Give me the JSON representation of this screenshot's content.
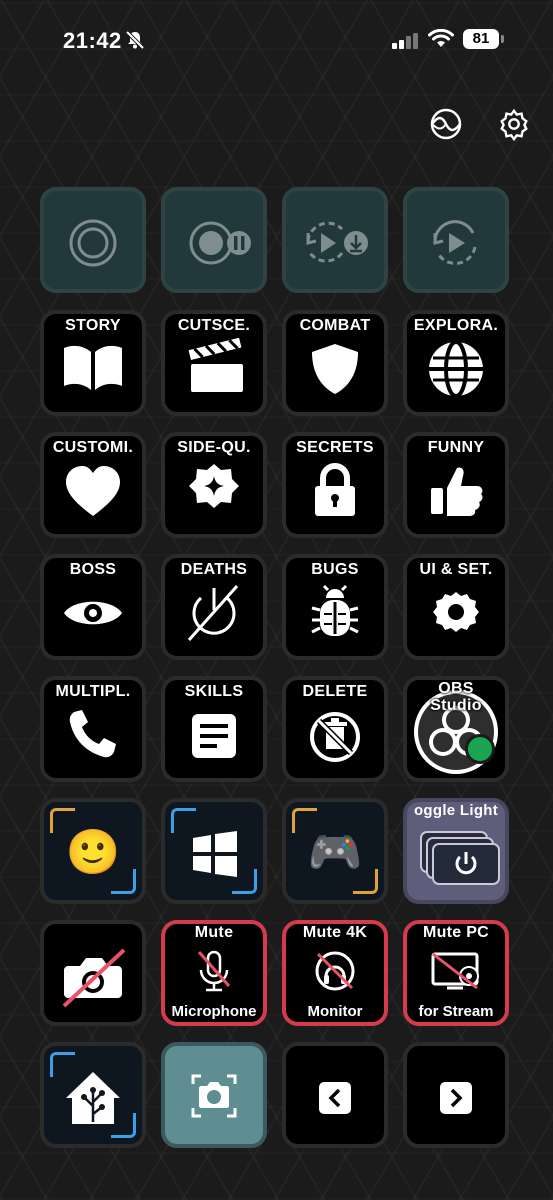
{
  "status_bar": {
    "time": "21:42",
    "battery": "81",
    "icons": [
      "bell-slash-icon",
      "signal-icon",
      "wifi-icon",
      "battery-icon"
    ]
  },
  "header": {
    "icons": [
      "stream-deck-profile-icon",
      "gear-icon"
    ]
  },
  "keys": {
    "r1": [
      {
        "icon": "record-icon"
      },
      {
        "icon": "record-pause-icon"
      },
      {
        "icon": "replay-buffer-save-icon"
      },
      {
        "icon": "replay-buffer-icon"
      }
    ],
    "story": "STORY",
    "cutscene": "CUTSCE.",
    "combat": "COMBAT",
    "exploration": "EXPLORA.",
    "customization": "CUSTOMI.",
    "side_quests": "SIDE-QU.",
    "secrets": "SECRETS",
    "funny": "FUNNY",
    "boss": "BOSS",
    "deaths": "DEATHS",
    "bugs": "BUGS",
    "ui_settings": "UI & SET.",
    "multiplayer": "MULTIPL.",
    "skills": "SKILLS",
    "delete": "DELETE",
    "obs_line1": "OBS",
    "obs_line2": "Studio",
    "emoji": "🙂",
    "gamepad": "🎮",
    "toggle_lights": "oggle Light",
    "mute_mic_top": "Mute",
    "mute_mic_bottom": "Microphone",
    "mute_monitor_top": "Mute 4K",
    "mute_monitor_bottom": "Monitor",
    "mute_pc_top": "Mute PC",
    "mute_pc_bottom": "for Stream"
  },
  "colors": {
    "teal": "#22393b",
    "teal_bright": "#5e8d92",
    "mute_red": "#d53b4c",
    "obs_green": "#1aa650",
    "windows_blue": "#3aa0e8",
    "orange": "#e0a33a"
  }
}
